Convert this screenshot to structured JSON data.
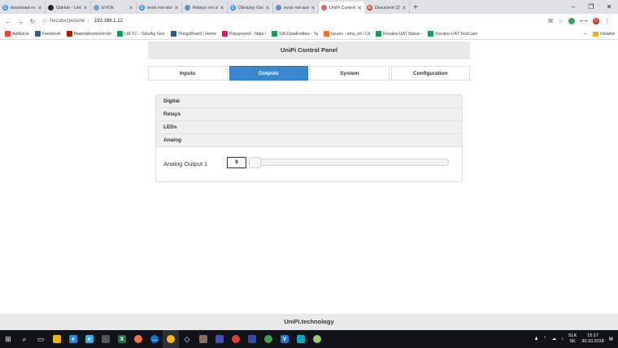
{
  "browser": {
    "tabs": [
      {
        "label": "download evo",
        "color": "#4285f4",
        "glyph": "G",
        "active": false
      },
      {
        "label": "GitHub - UniPi",
        "color": "#24292e",
        "glyph": "",
        "active": false
      },
      {
        "label": "EVOK",
        "color": "#7a9cc6",
        "glyph": "",
        "active": false
      },
      {
        "label": "evok not wor",
        "color": "#4285f4",
        "glyph": "G",
        "active": false
      },
      {
        "label": "Relays not sho",
        "color": "#6c8ebf",
        "glyph": "",
        "active": false
      },
      {
        "label": "Obrázky Goog",
        "color": "#4285f4",
        "glyph": "G",
        "active": false
      },
      {
        "label": "evok not work",
        "color": "#6c8ebf",
        "glyph": "",
        "active": false
      },
      {
        "label": "UniPi Control",
        "color": "#e06666",
        "glyph": "",
        "active": true
      },
      {
        "label": "Doručené (2)",
        "color": "#d93025",
        "glyph": "M",
        "active": false
      }
    ],
    "new_tab": "+",
    "window_controls": [
      "–",
      "❐",
      "✕"
    ],
    "insecure_label": "Nezabezpečené",
    "url": "192.168.1.12",
    "profile_initial": "D",
    "bookmarks": [
      {
        "label": "Aplikácie",
        "color": "#ea4335"
      },
      {
        "label": "Facebook",
        "color": "#3b5998"
      },
      {
        "label": "Materiálovotechnolo",
        "color": "#a61c00"
      },
      {
        "label": "LM-TC - Tabuľky Goo",
        "color": "#0f9d58"
      },
      {
        "label": "ThingsBoard | Home",
        "color": "#305680"
      },
      {
        "label": "Playground - https:/",
        "color": "#d81b60"
      },
      {
        "label": "SW-DataEntities - Ta",
        "color": "#0f9d58"
      },
      {
        "label": "Issues · oms_int / Cli",
        "color": "#fc6d26"
      },
      {
        "label": "Kovalov.UAT.Status -",
        "color": "#0f9d58"
      },
      {
        "label": "Kovalov.UAT.TestCase",
        "color": "#0f9d58"
      }
    ],
    "bookmarks_more": "»",
    "bookmarks_other": "Ostatné"
  },
  "app": {
    "header_title": "UniPi Control Panel",
    "tabs": [
      {
        "label": "Inputs",
        "active": false
      },
      {
        "label": "Outputs",
        "active": true
      },
      {
        "label": "System",
        "active": false
      },
      {
        "label": "Configuration",
        "active": false
      }
    ],
    "sections": [
      "Digital",
      "Relays",
      "LEDs",
      "Analog"
    ],
    "analog_output": {
      "label": "Analog Output 1",
      "value": "0",
      "slider_fraction": 0
    },
    "footer": "UniPi.technology"
  },
  "taskbar": {
    "lang_top": "SLK",
    "lang_bottom": "SK",
    "time": "15:17",
    "date": "30.10.2018"
  }
}
